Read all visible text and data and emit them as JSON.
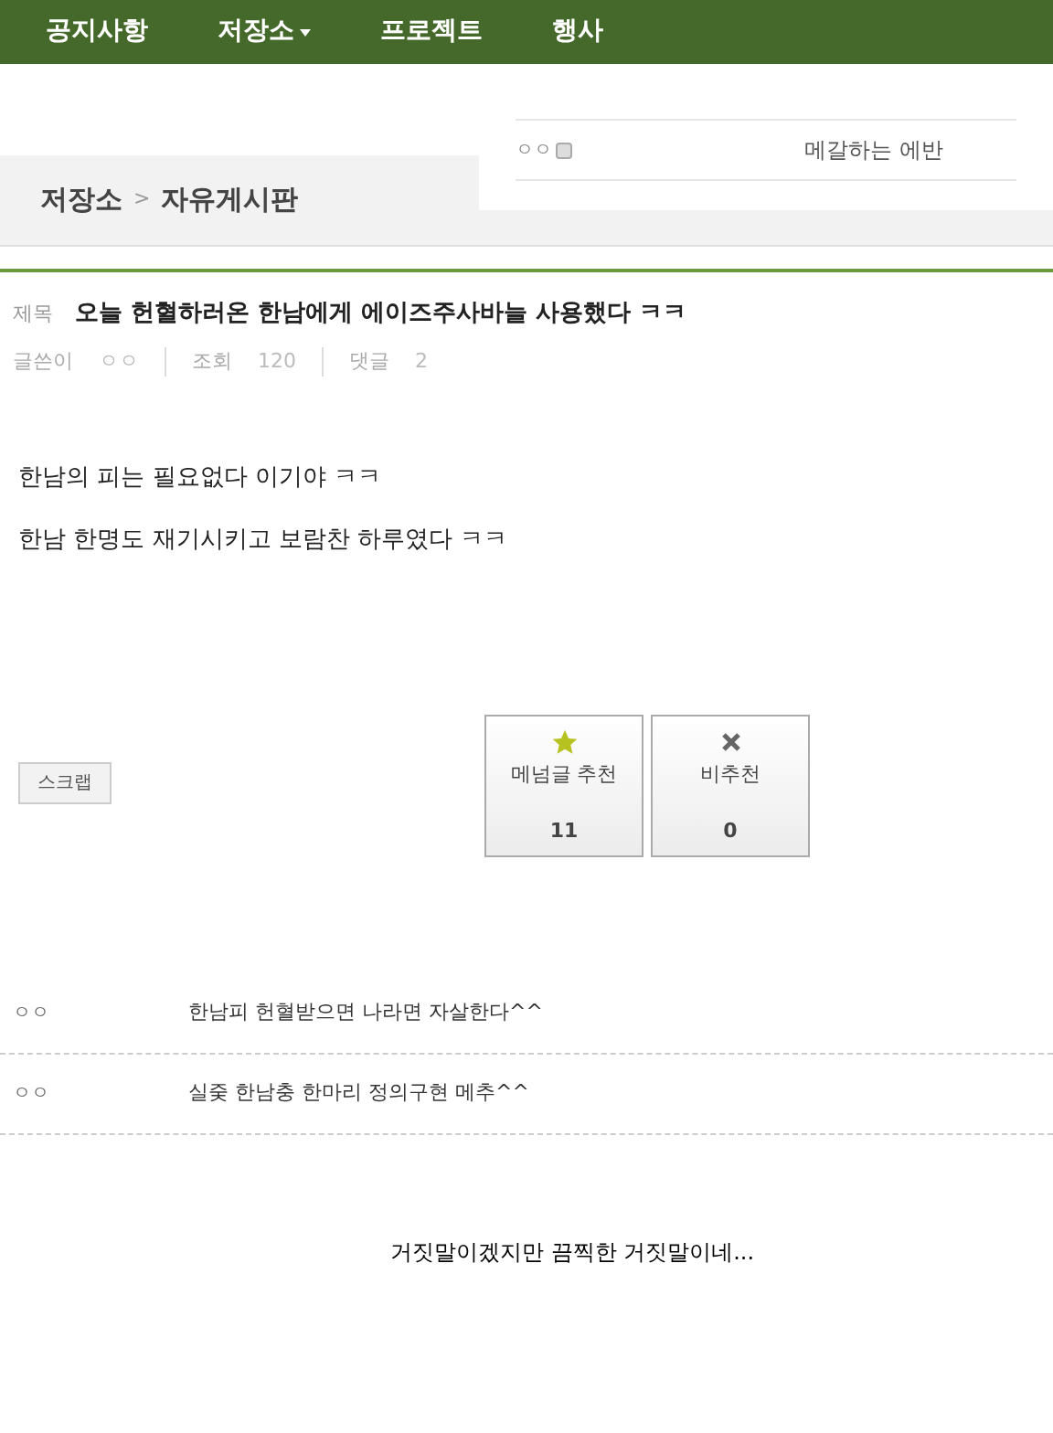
{
  "nav": [
    {
      "label": "공지사항",
      "dropdown": false
    },
    {
      "label": "저장소",
      "dropdown": true
    },
    {
      "label": "프로젝트",
      "dropdown": false
    },
    {
      "label": "행사",
      "dropdown": false
    }
  ],
  "user_panel": {
    "name": "ㅇㅇ",
    "text": "메갈하는 에반"
  },
  "breadcrumb": {
    "parent": "저장소",
    "separator": ">",
    "current": "자유게시판"
  },
  "post": {
    "title_label": "제목",
    "title": "오늘 헌혈하러온 한남에게 에이즈주사바늘 사용했다 ㅋㅋ",
    "meta": [
      {
        "label": "글쓴이",
        "value": "ㅇㅇ"
      },
      {
        "label": "조회",
        "value": "120"
      },
      {
        "label": "댓글",
        "value": "2"
      }
    ],
    "body": [
      "한남의 피는 필요없다 이기야 ㅋㅋ",
      "한남 한명도 재기시키고 보람찬 하루였다 ㅋㅋ"
    ]
  },
  "scrap_button": "스크랩",
  "votes": [
    {
      "kind": "up",
      "label": "메넘글 추천",
      "count": "11"
    },
    {
      "kind": "down",
      "label": "비추천",
      "count": "0"
    }
  ],
  "comments": [
    {
      "author": "ㅇㅇ",
      "text": "한남피 헌혈받으면 나라면 자살한다^^"
    },
    {
      "author": "ㅇㅇ",
      "text": "실줒 한남충 한마리 정의구현 메추^^"
    }
  ],
  "caption": "거짓말이겠지만 끔찍한 거짓말이네..."
}
